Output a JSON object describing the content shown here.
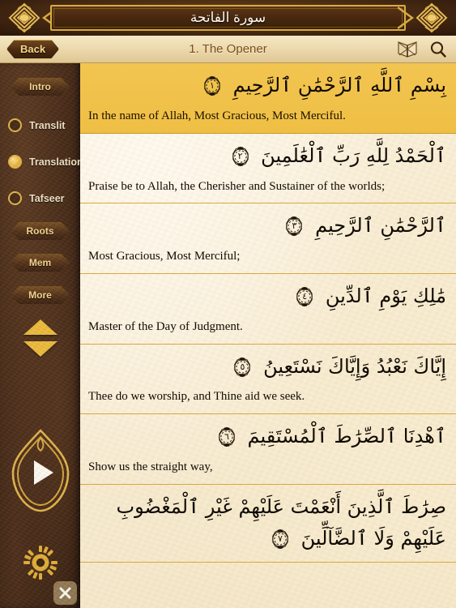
{
  "titlebar": {
    "title": "سورة الفاتحة",
    "left_ornament": "rosette-icon",
    "right_ornament": "rosette-icon"
  },
  "subbar": {
    "back_label": "Back",
    "surah_label": "1. The Opener",
    "book_icon": "open-book-icon",
    "search_icon": "search-icon"
  },
  "sidebar": {
    "intro_label": "Intro",
    "view_modes": [
      {
        "label": "Translit",
        "selected": false
      },
      {
        "label": "Translation",
        "selected": true
      },
      {
        "label": "Tafseer",
        "selected": false
      }
    ],
    "roots_label": "Roots",
    "mem_label": "Mem",
    "more_label": "More",
    "scroll_up_icon": "triangle-up-icon",
    "scroll_down_icon": "triangle-down-icon",
    "play_icon": "play-icon",
    "settings_icon": "gear-icon",
    "close_icon": "close-icon"
  },
  "colors": {
    "gold": "#d7a93f",
    "highlight_bg": "#efc044",
    "parchment": "#faf0d8",
    "leather": "#3c2413",
    "title_text": "#fdf8ee",
    "label_gold": "#f8d98c"
  },
  "verses": [
    {
      "number": "١",
      "arabic": "بِسْمِ ٱللَّهِ ٱلرَّحْمَٰنِ ٱلرَّحِيمِ",
      "translation": "In the name of Allah, Most Gracious, Most Merciful.",
      "highlighted": true
    },
    {
      "number": "٢",
      "arabic": "ٱلْحَمْدُ لِلَّهِ رَبِّ ٱلْعَٰلَمِينَ",
      "translation": "Praise be to Allah, the Cherisher and Sustainer of the worlds;",
      "highlighted": false
    },
    {
      "number": "٣",
      "arabic": "ٱلرَّحْمَٰنِ ٱلرَّحِيمِ",
      "translation": "Most Gracious, Most Merciful;",
      "highlighted": false
    },
    {
      "number": "٤",
      "arabic": "مَٰلِكِ يَوْمِ ٱلدِّينِ",
      "translation": "Master of the Day of Judgment.",
      "highlighted": false
    },
    {
      "number": "٥",
      "arabic": "إِيَّاكَ نَعْبُدُ وَإِيَّاكَ نَسْتَعِينُ",
      "translation": "Thee do we worship, and Thine aid we seek.",
      "highlighted": false
    },
    {
      "number": "٦",
      "arabic": "ٱهْدِنَا ٱلصِّرَٰطَ ٱلْمُسْتَقِيمَ",
      "translation": "Show us the straight way,",
      "highlighted": false
    },
    {
      "number": "٧",
      "arabic": "صِرَٰطَ ٱلَّذِينَ أَنْعَمْتَ عَلَيْهِمْ غَيْرِ ٱلْمَغْضُوبِ عَلَيْهِمْ وَلَا ٱلضَّآلِّينَ",
      "translation": "",
      "highlighted": false
    }
  ]
}
